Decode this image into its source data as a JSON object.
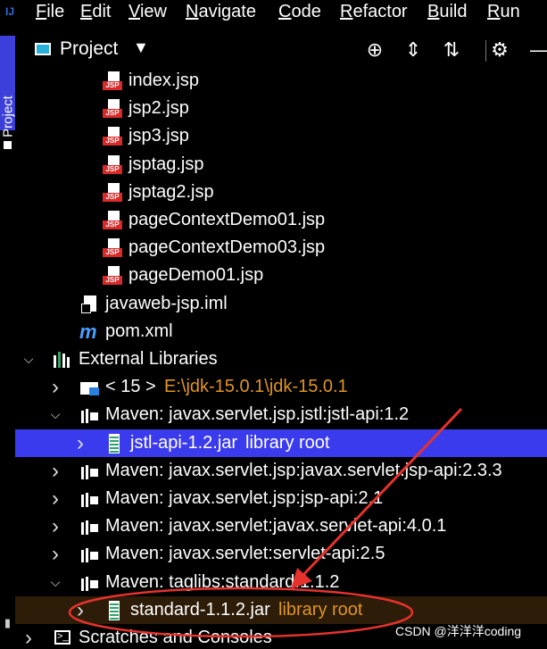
{
  "menu": {
    "items": [
      {
        "mnemonic": "F",
        "rest": "ile"
      },
      {
        "mnemonic": "E",
        "rest": "dit"
      },
      {
        "mnemonic": "V",
        "rest": "iew"
      },
      {
        "mnemonic": "N",
        "rest": "avigate"
      },
      {
        "mnemonic": "C",
        "rest": "ode"
      },
      {
        "mnemonic": "R",
        "rest": "efactor"
      },
      {
        "mnemonic": "B",
        "rest": "uild"
      },
      {
        "mnemonic": "R",
        "rest": "un"
      }
    ]
  },
  "side_stripe": {
    "project_label": "Project"
  },
  "panel": {
    "title": "Project",
    "dropdown_icon": "caret-down-icon",
    "actions": [
      "locate-icon",
      "expand-all-icon",
      "collapse-all-icon",
      "gear-icon",
      "hide-icon"
    ]
  },
  "tree": {
    "rows": [
      {
        "kind": "jsp",
        "label": "index.jsp"
      },
      {
        "kind": "jsp",
        "label": "jsp2.jsp"
      },
      {
        "kind": "jsp",
        "label": "jsp3.jsp"
      },
      {
        "kind": "jsp",
        "label": "jsptag.jsp"
      },
      {
        "kind": "jsp",
        "label": "jsptag2.jsp"
      },
      {
        "kind": "jsp",
        "label": "pageContextDemo01.jsp"
      },
      {
        "kind": "jsp",
        "label": "pageContextDemo03.jsp"
      },
      {
        "kind": "jsp",
        "label": "pageDemo01.jsp"
      },
      {
        "kind": "file",
        "label": "javaweb-jsp.iml"
      },
      {
        "kind": "maven-pom",
        "label": "pom.xml"
      },
      {
        "kind": "external-libraries",
        "label": "External Libraries",
        "expanded": true
      },
      {
        "kind": "jdk",
        "label": "< 15 >",
        "extra": "E:\\jdk-15.0.1\\jdk-15.0.1",
        "expanded": false
      },
      {
        "kind": "maven-lib",
        "label": "Maven: javax.servlet.jsp.jstl:jstl-api:1.2",
        "expanded": true
      },
      {
        "kind": "jar",
        "label": "jstl-api-1.2.jar",
        "extra": "library root",
        "selected": true,
        "expanded": false
      },
      {
        "kind": "maven-lib",
        "label": "Maven: javax.servlet.jsp:javax.servlet.jsp-api:2.3.3",
        "expanded": false
      },
      {
        "kind": "maven-lib",
        "label": "Maven: javax.servlet.jsp:jsp-api:2.1",
        "expanded": false
      },
      {
        "kind": "maven-lib",
        "label": "Maven: javax.servlet:javax.servlet-api:4.0.1",
        "expanded": false
      },
      {
        "kind": "maven-lib",
        "label": "Maven: javax.servlet:servlet-api:2.5",
        "expanded": false
      },
      {
        "kind": "maven-lib",
        "label": "Maven: taglibs:standard:1.1.2",
        "expanded": true
      },
      {
        "kind": "jar",
        "label": "standard-1.1.2.jar",
        "extra": "library root",
        "highlighted": true,
        "expanded": false
      },
      {
        "kind": "scratches",
        "label": "Scratches and Consoles",
        "expanded": false
      }
    ]
  },
  "annotation": {
    "color": "#e5322d"
  },
  "watermark": "CSDN @洋洋洋coding"
}
